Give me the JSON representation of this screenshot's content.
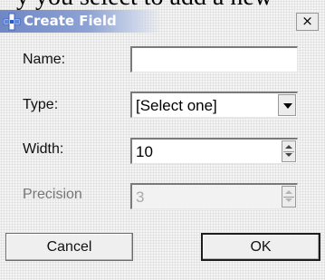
{
  "background_text": "y you select to add a new",
  "dialog": {
    "title": "Create Field",
    "close_glyph": "×",
    "icon": "create-field-plus-icon"
  },
  "form": {
    "name": {
      "label": "Name:",
      "value": ""
    },
    "type": {
      "label": "Type:",
      "value": "[Select one]"
    },
    "width": {
      "label": "Width:",
      "value": "10"
    },
    "precision": {
      "label": "Precision",
      "value": "3",
      "disabled": true
    }
  },
  "buttons": {
    "cancel": "Cancel",
    "ok": "OK"
  },
  "colors": {
    "title_gradient": "#6f87c6",
    "background": "#f4f4f4",
    "field_border": "#7a7a7a"
  }
}
